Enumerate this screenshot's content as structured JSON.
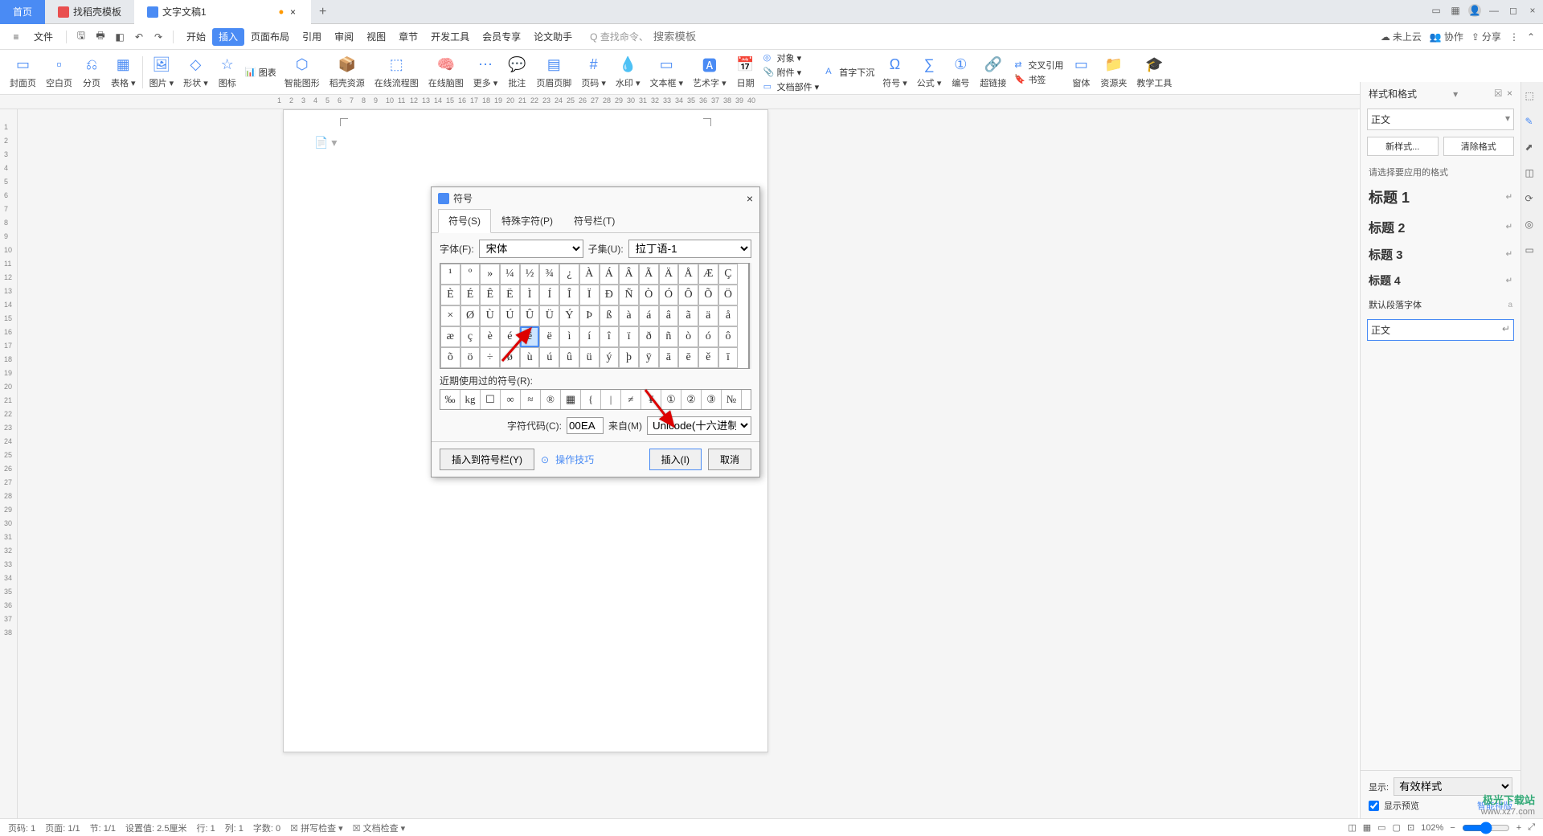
{
  "tabs": {
    "home": "首页",
    "template": "找稻壳模板",
    "doc": "文字文稿1",
    "add": "+"
  },
  "menu": {
    "file": "文件",
    "items": [
      "开始",
      "插入",
      "页面布局",
      "引用",
      "审阅",
      "视图",
      "章节",
      "开发工具",
      "会员专享",
      "论文助手"
    ],
    "active_index": 1,
    "search_prefix": "Q 查找命令、",
    "search_placeholder": "搜索模板",
    "cloud": "未上云",
    "collab": "协作",
    "share": "分享"
  },
  "ribbon": {
    "items": [
      "封面页",
      "空白页",
      "分页",
      "表格",
      "图片",
      "形状",
      "图标",
      "智能图形",
      "稻壳资源",
      "在线流程图",
      "在线脑图",
      "更多",
      "批注",
      "页眉页脚",
      "页码",
      "水印",
      "文本框",
      "艺术字",
      "日期",
      "符号",
      "公式",
      "编号",
      "超链接",
      "窗体",
      "资源夹",
      "教学工具"
    ],
    "stack1": [
      "图表",
      ""
    ],
    "stack_obj": [
      "对象",
      "附件",
      "文档部件"
    ],
    "stack_obj2": [
      "首字下沉",
      "",
      ""
    ],
    "stack_ref": [
      "交叉引用",
      "书签"
    ]
  },
  "dialog": {
    "title": "符号",
    "tabs": [
      "符号(S)",
      "特殊字符(P)",
      "符号栏(T)"
    ],
    "font_label": "字体(F):",
    "font_value": "宋体",
    "subset_label": "子集(U):",
    "subset_value": "拉丁语-1",
    "chars_r1": [
      "¹",
      "º",
      "»",
      "¼",
      "½",
      "¾",
      "¿",
      "À",
      "Á",
      "Â",
      "Ã",
      "Ä",
      "Å",
      "Æ",
      "Ç"
    ],
    "chars_r2": [
      "È",
      "É",
      "Ê",
      "Ë",
      "Ì",
      "Í",
      "Î",
      "Ï",
      "Ð",
      "Ñ",
      "Ò",
      "Ó",
      "Ô",
      "Õ",
      "Ö"
    ],
    "chars_r3": [
      "×",
      "Ø",
      "Ù",
      "Ú",
      "Û",
      "Ü",
      "Ý",
      "Þ",
      "ß",
      "à",
      "á",
      "â",
      "ã",
      "ä",
      "å"
    ],
    "chars_r4": [
      "æ",
      "ç",
      "è",
      "é",
      "ê",
      "ë",
      "ì",
      "í",
      "î",
      "ï",
      "ð",
      "ñ",
      "ò",
      "ó",
      "ô"
    ],
    "chars_r5": [
      "õ",
      "ö",
      "÷",
      "ø",
      "ù",
      "ú",
      "û",
      "ü",
      "ý",
      "þ",
      "ÿ",
      "ā",
      "ē",
      "ě",
      "ī"
    ],
    "selected_row": 3,
    "selected_col": 4,
    "recent_label": "近期使用过的符号(R):",
    "recent": [
      "‰",
      "kg",
      "☐",
      "∞",
      "≈",
      "®",
      "▦",
      "{",
      "|",
      "≠",
      "¥",
      "①",
      "②",
      "③",
      "№"
    ],
    "code_label": "字符代码(C):",
    "code_value": "00EA",
    "from_label": "来自(M)",
    "from_value": "Unicode(十六进制)",
    "insert_bar": "插入到符号栏(Y)",
    "tips": "操作技巧",
    "insert_btn": "插入(I)",
    "cancel_btn": "取消"
  },
  "styles": {
    "title": "样式和格式",
    "current": "正文",
    "new_btn": "新样式...",
    "clear_btn": "清除格式",
    "list_label": "请选择要应用的格式",
    "items": [
      "标题 1",
      "标题 2",
      "标题 3",
      "标题 4"
    ],
    "default_font": "默认段落字体",
    "body_style": "正文",
    "display_label": "显示:",
    "display_value": "有效样式",
    "preview": "显示预览",
    "smart": "智能排版"
  },
  "status": {
    "page_no": "页码: 1",
    "page": "页面: 1/1",
    "section": "节: 1/1",
    "set_value": "设置值: 2.5厘米",
    "row": "行: 1",
    "col": "列: 1",
    "chars": "字数: 0",
    "spell": "拼写检查",
    "doc_check": "文档检查",
    "zoom": "102%"
  },
  "watermark": {
    "brand": "极光下载站",
    "url": "www.xz7.com"
  }
}
